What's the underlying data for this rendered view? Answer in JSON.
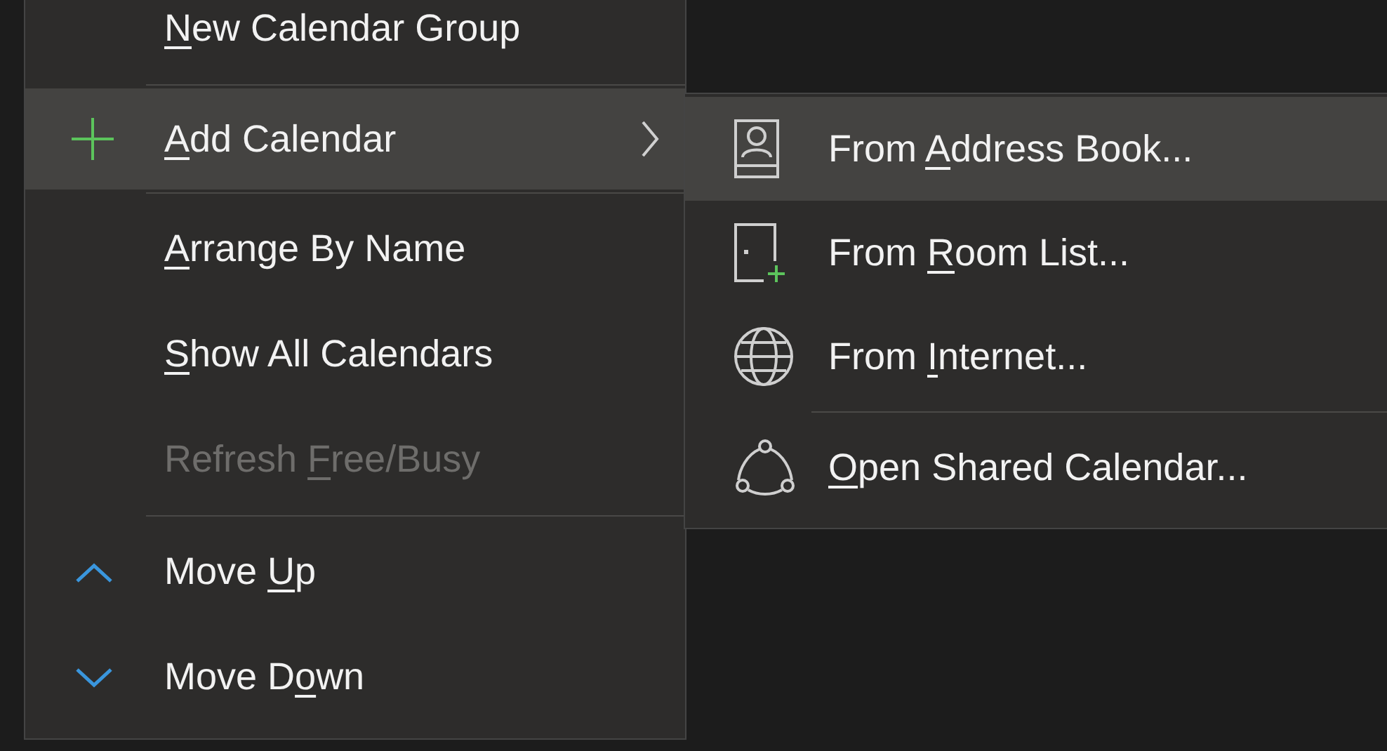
{
  "menu": {
    "items": [
      {
        "kind": "command",
        "key": "N",
        "post": "ew Calendar Group",
        "selected": false,
        "disabled": false
      },
      {
        "kind": "separator"
      },
      {
        "kind": "submenu",
        "key": "A",
        "post": "dd Calendar",
        "selected": true,
        "disabled": false,
        "expanded": true
      },
      {
        "kind": "separator"
      },
      {
        "kind": "command",
        "key": "A",
        "post": "rrange By Name",
        "selected": false,
        "disabled": false
      },
      {
        "kind": "command",
        "key": "S",
        "post": "how All Calendars",
        "selected": false,
        "disabled": false
      },
      {
        "kind": "command",
        "pre": "Refresh ",
        "key": "F",
        "post": "ree/Busy",
        "selected": false,
        "disabled": true
      },
      {
        "kind": "separator"
      },
      {
        "kind": "command",
        "pre": "Move ",
        "key": "U",
        "post": "p",
        "selected": false,
        "disabled": false
      },
      {
        "kind": "command",
        "pre": "Move D",
        "key": "o",
        "post": "wn",
        "selected": false,
        "disabled": false
      }
    ]
  },
  "submenu": {
    "items": [
      {
        "kind": "command",
        "pre": "From ",
        "key": "A",
        "post": "ddress Book...",
        "selected": true,
        "disabled": false
      },
      {
        "kind": "command",
        "pre": "From ",
        "key": "R",
        "post": "oom List...",
        "selected": false,
        "disabled": false
      },
      {
        "kind": "command",
        "pre": "From ",
        "key": "I",
        "post": "nternet...",
        "selected": false,
        "disabled": false
      },
      {
        "kind": "separator"
      },
      {
        "kind": "command",
        "key": "O",
        "post": "pen Shared Calendar...",
        "selected": false,
        "disabled": false
      }
    ]
  }
}
